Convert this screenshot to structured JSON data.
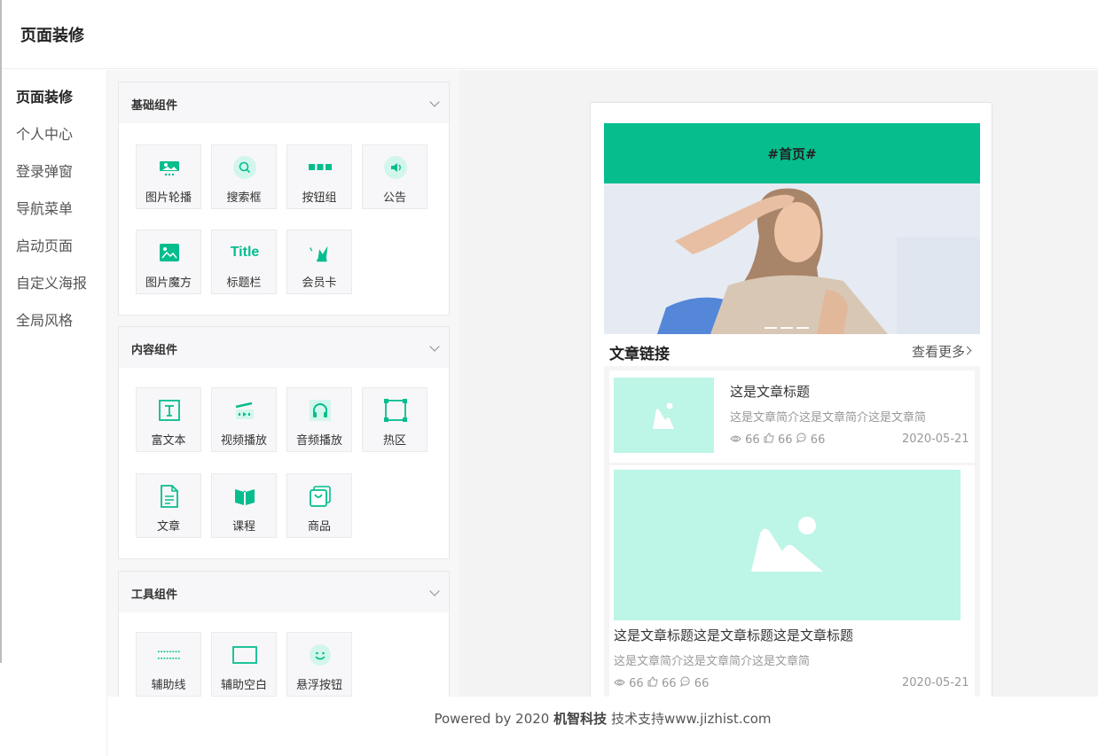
{
  "header": {
    "title": "页面装修"
  },
  "sidebar": {
    "items": [
      {
        "label": "页面装修",
        "active": true
      },
      {
        "label": "个人中心"
      },
      {
        "label": "登录弹窗"
      },
      {
        "label": "导航菜单"
      },
      {
        "label": "启动页面"
      },
      {
        "label": "自定义海报"
      },
      {
        "label": "全局风格"
      }
    ]
  },
  "groups": [
    {
      "title": "基础组件",
      "tiles": [
        {
          "label": "图片轮播",
          "icon": "carousel-icon"
        },
        {
          "label": "搜索框",
          "icon": "search-icon"
        },
        {
          "label": "按钮组",
          "icon": "button-group-icon"
        },
        {
          "label": "公告",
          "icon": "speaker-icon"
        },
        {
          "label": "图片魔方",
          "icon": "image-cube-icon"
        },
        {
          "label": "标题栏",
          "icon": "title-icon",
          "glyph": "Title"
        },
        {
          "label": "会员卡",
          "icon": "crown-icon"
        }
      ]
    },
    {
      "title": "内容组件",
      "tiles": [
        {
          "label": "富文本",
          "icon": "rich-text-icon",
          "glyph": "T"
        },
        {
          "label": "视频播放",
          "icon": "video-icon"
        },
        {
          "label": "音频播放",
          "icon": "headphone-icon"
        },
        {
          "label": "热区",
          "icon": "hotspot-icon"
        },
        {
          "label": "文章",
          "icon": "article-icon"
        },
        {
          "label": "课程",
          "icon": "course-icon"
        },
        {
          "label": "商品",
          "icon": "goods-icon"
        }
      ]
    },
    {
      "title": "工具组件",
      "tiles": [
        {
          "label": "辅助线",
          "icon": "divider-icon"
        },
        {
          "label": "辅助空白",
          "icon": "blank-icon"
        },
        {
          "label": "悬浮按钮",
          "icon": "float-button-icon"
        }
      ]
    }
  ],
  "preview": {
    "topbar_title": "#首页#",
    "section_title": "文章链接",
    "section_more": "查看更多",
    "articles": [
      {
        "title": "这是文章标题",
        "desc": "这是文章简介这是文章简介这是文章简",
        "views": "66",
        "likes": "66",
        "comments": "66",
        "date": "2020-05-21"
      },
      {
        "title": "这是文章标题这是文章标题这是文章标题",
        "desc": "这是文章简介这是文章简介这是文章简",
        "views": "66",
        "likes": "66",
        "comments": "66",
        "date": "2020-05-21"
      }
    ]
  },
  "footer": {
    "prefix": "Powered by 2020",
    "brand": "机智科技",
    "suffix": "技术支持www.jizhist.com"
  },
  "colors": {
    "accent": "#06bd8e",
    "placeholder": "#bdf5e7"
  }
}
